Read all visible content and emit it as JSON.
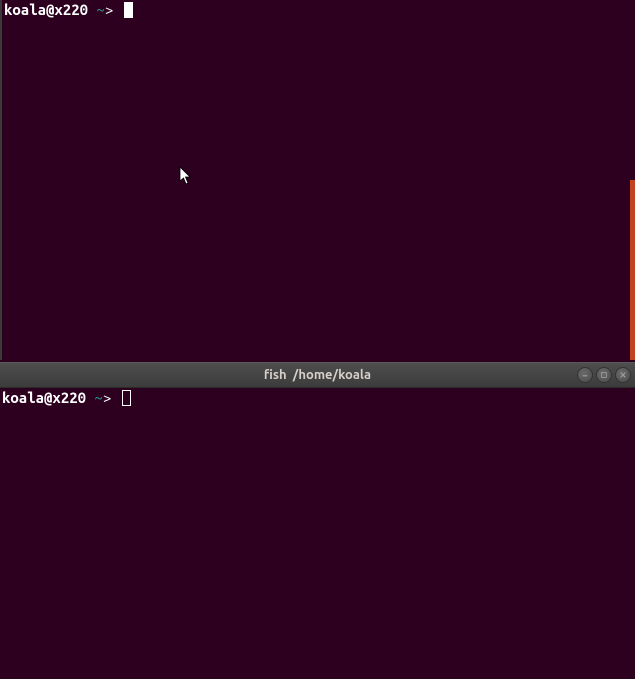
{
  "panes": {
    "top": {
      "prompt": {
        "userhost": "koala@x220 ",
        "tilde": "~",
        "arrow": "> "
      }
    },
    "bottom": {
      "prompt": {
        "userhost": "koala@x220 ",
        "tilde": "~",
        "arrow": "> "
      }
    }
  },
  "titlebar": {
    "app": "fish",
    "path": "/home/koala",
    "full": "fish  /home/koala"
  },
  "window_controls": {
    "minimize": "minimize",
    "maximize": "maximize",
    "close": "close"
  },
  "colors": {
    "background": "#2c001e",
    "accent": "#e95420",
    "cyan": "#2aa198",
    "titlebar": "#3c3c3c"
  }
}
